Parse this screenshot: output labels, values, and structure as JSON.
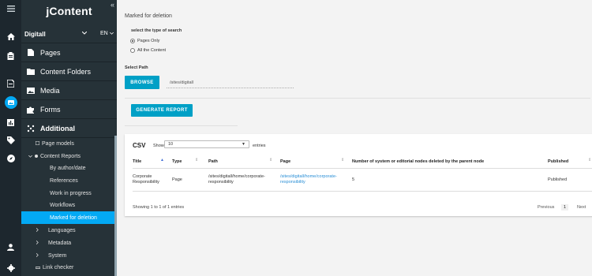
{
  "app": {
    "title": "jContent",
    "collapse_icon": "«"
  },
  "site": {
    "name": "Digitall",
    "language": "EN"
  },
  "rail_icons": [
    "menu-icon",
    "home-icon",
    "clipboard-icon",
    "page-icon",
    "content-icon",
    "dashboard-icon",
    "tag-icon",
    "compass-icon",
    "user-icon",
    "settings-icon"
  ],
  "nav": {
    "pages": "Pages",
    "content_folders": "Content Folders",
    "media": "Media",
    "forms": "Forms",
    "additional": "Additional"
  },
  "tree": {
    "page_models": "Page models",
    "content_reports": "Content Reports",
    "by_author_date": "By author/date",
    "references": "References",
    "work_in_progress": "Work in progress",
    "workflows": "Workflows",
    "marked_for_deletion": "Marked for deletion",
    "languages": "Languages",
    "metadata": "Metadata",
    "system": "System",
    "link_checker": "Link checker"
  },
  "main": {
    "title": "Marked for deletion",
    "search_type_label": "select the type of search",
    "options": [
      {
        "label": "Pages Only",
        "selected": true
      },
      {
        "label": "All the Content",
        "selected": false
      }
    ],
    "select_path_label": "Select Path",
    "browse_label": "BROWSE",
    "path_value": "/sites/digitall",
    "generate_label": "GENERATE REPORT"
  },
  "table": {
    "csv_label": "CSV",
    "show_label": "Show",
    "page_size": "10",
    "entries_label": "entries",
    "columns": [
      "Title",
      "Type",
      "Path",
      "Page",
      "Number of system or editorial nodes deleted by the parent node",
      "Published"
    ],
    "rows": [
      {
        "title": "Corporate Responsibility",
        "type": "Page",
        "path": "/sites/digitall/home/corporate-responsibility",
        "page": "/sites/digitall/home/corporate-responsibility",
        "count": "5",
        "published": "Published"
      }
    ],
    "info": "Showing 1 to 1 of 1 entries",
    "previous": "Previous",
    "current_page": "1",
    "next": "Next"
  },
  "colors": {
    "rail_bg": "#1d272e",
    "sidebar_bg": "#263238",
    "accent": "#03a9f4",
    "button": "#00a0c6",
    "link": "#2a8fd6"
  }
}
